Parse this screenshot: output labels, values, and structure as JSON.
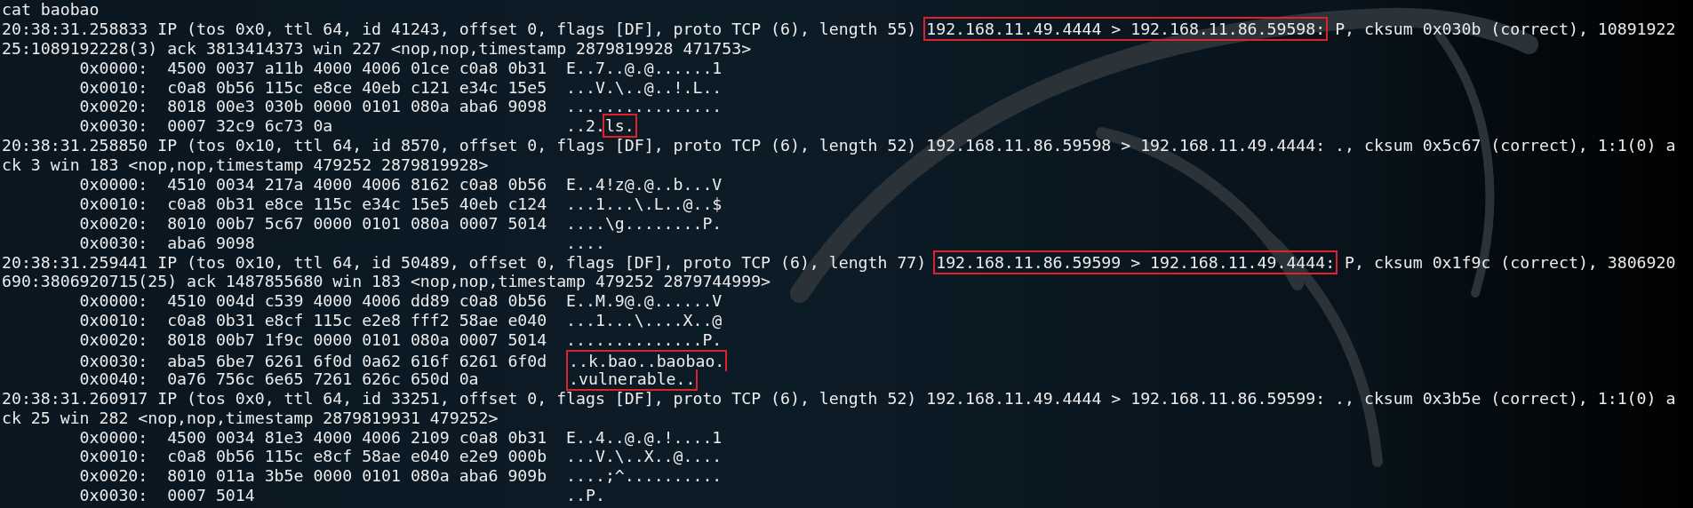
{
  "terminal": {
    "lines": [
      {
        "kind": "text",
        "segments": [
          {
            "text": "cat baobao",
            "highlighted": false
          }
        ]
      },
      {
        "kind": "text",
        "segments": [
          {
            "text": "20:38:31.258833 IP (tos 0x0, ttl 64, id 41243, offset 0, flags [DF], proto TCP (6), length 55) ",
            "highlighted": false
          },
          {
            "text": "192.168.11.49.4444 > 192.168.11.86.59598:",
            "highlighted": true
          },
          {
            "text": " P, cksum 0x030b (correct), 10891922",
            "highlighted": false
          }
        ]
      },
      {
        "kind": "text",
        "segments": [
          {
            "text": "25:1089192228(3) ack 3813414373 win 227 <nop,nop,timestamp 2879819928 471753>",
            "highlighted": false
          }
        ]
      },
      {
        "kind": "hex",
        "offset": "0x0000:",
        "hex": "4500 0037 a11b 4000 4006 01ce c0a8 0b31",
        "ascii": [
          {
            "text": "E..7..@.@......1",
            "highlighted": false
          }
        ]
      },
      {
        "kind": "hex",
        "offset": "0x0010:",
        "hex": "c0a8 0b56 115c e8ce 40eb c121 e34c 15e5",
        "ascii": [
          {
            "text": "...V.\\..@..!.L..",
            "highlighted": false
          }
        ]
      },
      {
        "kind": "hex",
        "offset": "0x0020:",
        "hex": "8018 00e3 030b 0000 0101 080a aba6 9098",
        "ascii": [
          {
            "text": "................",
            "highlighted": false
          }
        ]
      },
      {
        "kind": "hex",
        "offset": "0x0030:",
        "hex": "0007 32c9 6c73 0a",
        "ascii": [
          {
            "text": "..2.",
            "highlighted": false
          },
          {
            "text": "ls.",
            "highlighted": true
          }
        ]
      },
      {
        "kind": "text",
        "segments": [
          {
            "text": "20:38:31.258850 IP (tos 0x10, ttl 64, id 8570, offset 0, flags [DF], proto TCP (6), length 52) 192.168.11.86.59598 > 192.168.11.49.4444: ., cksum 0x5c67 (correct), 1:1(0) a",
            "highlighted": false
          }
        ]
      },
      {
        "kind": "text",
        "segments": [
          {
            "text": "ck 3 win 183 <nop,nop,timestamp 479252 2879819928>",
            "highlighted": false
          }
        ]
      },
      {
        "kind": "hex",
        "offset": "0x0000:",
        "hex": "4510 0034 217a 4000 4006 8162 c0a8 0b56",
        "ascii": [
          {
            "text": "E..4!z@.@..b...V",
            "highlighted": false
          }
        ]
      },
      {
        "kind": "hex",
        "offset": "0x0010:",
        "hex": "c0a8 0b31 e8ce 115c e34c 15e5 40eb c124",
        "ascii": [
          {
            "text": "...1...\\.L..@..$",
            "highlighted": false
          }
        ]
      },
      {
        "kind": "hex",
        "offset": "0x0020:",
        "hex": "8010 00b7 5c67 0000 0101 080a 0007 5014",
        "ascii": [
          {
            "text": "....\\g........P.",
            "highlighted": false
          }
        ]
      },
      {
        "kind": "hex",
        "offset": "0x0030:",
        "hex": "aba6 9098",
        "ascii": [
          {
            "text": "....",
            "highlighted": false
          }
        ]
      },
      {
        "kind": "text",
        "segments": [
          {
            "text": "20:38:31.259441 IP (tos 0x10, ttl 64, id 50489, offset 0, flags [DF], proto TCP (6), length 77) ",
            "highlighted": false
          },
          {
            "text": "192.168.11.86.59599 > 192.168.11.49.4444:",
            "highlighted": true
          },
          {
            "text": " P, cksum 0x1f9c (correct), 3806920",
            "highlighted": false
          }
        ]
      },
      {
        "kind": "text",
        "segments": [
          {
            "text": "690:3806920715(25) ack 1487855680 win 183 <nop,nop,timestamp 479252 2879744999>",
            "highlighted": false
          }
        ]
      },
      {
        "kind": "hex",
        "offset": "0x0000:",
        "hex": "4510 004d c539 4000 4006 dd89 c0a8 0b56",
        "ascii": [
          {
            "text": "E..M.9@.@......V",
            "highlighted": false
          }
        ]
      },
      {
        "kind": "hex",
        "offset": "0x0010:",
        "hex": "c0a8 0b31 e8cf 115c e2e8 fff2 58ae e040",
        "ascii": [
          {
            "text": "...1...\\....X..@",
            "highlighted": false
          }
        ]
      },
      {
        "kind": "hex",
        "offset": "0x0020:",
        "hex": "8018 00b7 1f9c 0000 0101 080a 0007 5014",
        "ascii": [
          {
            "text": "..............P.",
            "highlighted": false
          }
        ]
      },
      {
        "kind": "hex",
        "offset": "0x0030:",
        "hex": "aba5 6be7 6261 6f0d 0a62 616f 6261 6f0d",
        "ascii": [
          {
            "text": "..k.bao..baobao.",
            "highlighted": true
          }
        ]
      },
      {
        "kind": "hex",
        "offset": "0x0040:",
        "hex": "0a76 756c 6e65 7261 626c 650d 0a",
        "ascii": [
          {
            "text": ".vulnerable..",
            "highlighted": true
          }
        ]
      },
      {
        "kind": "text",
        "segments": [
          {
            "text": "20:38:31.260917 IP (tos 0x0, ttl 64, id 33251, offset 0, flags [DF], proto TCP (6), length 52) 192.168.11.49.4444 > 192.168.11.86.59599: ., cksum 0x3b5e (correct), 1:1(0) a",
            "highlighted": false
          }
        ]
      },
      {
        "kind": "text",
        "segments": [
          {
            "text": "ck 25 win 282 <nop,nop,timestamp 2879819931 479252>",
            "highlighted": false
          }
        ]
      },
      {
        "kind": "hex",
        "offset": "0x0000:",
        "hex": "4500 0034 81e3 4000 4006 2109 c0a8 0b31",
        "ascii": [
          {
            "text": "E..4..@.@.!....1",
            "highlighted": false
          }
        ]
      },
      {
        "kind": "hex",
        "offset": "0x0010:",
        "hex": "c0a8 0b56 115c e8cf 58ae e040 e2e9 000b",
        "ascii": [
          {
            "text": "...V.\\..X..@....",
            "highlighted": false
          }
        ]
      },
      {
        "kind": "hex",
        "offset": "0x0020:",
        "hex": "8010 011a 3b5e 0000 0101 080a aba6 909b",
        "ascii": [
          {
            "text": "....;^..........",
            "highlighted": false
          }
        ]
      },
      {
        "kind": "hex",
        "offset": "0x0030:",
        "hex": "0007 5014",
        "ascii": [
          {
            "text": "..P.",
            "highlighted": false
          }
        ]
      }
    ]
  }
}
